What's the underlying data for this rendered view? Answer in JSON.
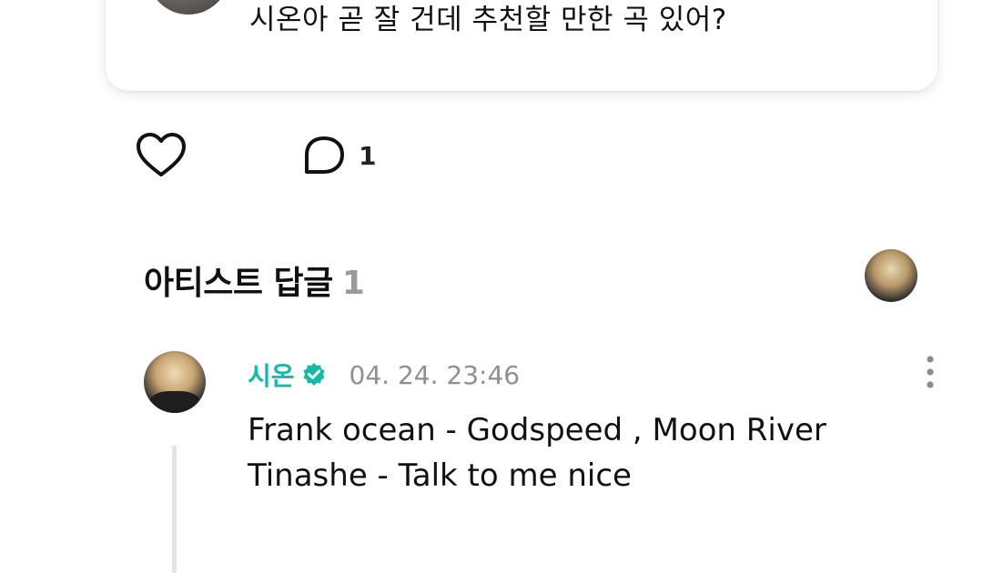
{
  "post": {
    "text": "시온아 곧 잘 건데 추천할 만한 곡 있어?"
  },
  "actions": {
    "comment_count": "1"
  },
  "artist_replies": {
    "title": "아티스트 답글",
    "count": "1"
  },
  "reply": {
    "author": "시온",
    "timestamp": "04. 24. 23:46",
    "lines": [
      "Frank ocean - Godspeed , Moon River",
      "Tinashe - Talk to me nice"
    ]
  },
  "colors": {
    "accent": "#16b9a8",
    "muted": "#8f8f8f",
    "count_gray": "#9a9a9a"
  },
  "icons": {
    "like": "heart-icon",
    "comment": "comment-bubble-icon",
    "verified": "verified-badge-icon",
    "more": "more-vertical-icon"
  }
}
